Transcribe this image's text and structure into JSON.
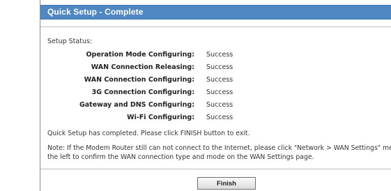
{
  "header": {
    "title": "Quick Setup - Complete"
  },
  "status": {
    "title": "Setup Status:",
    "rows": [
      {
        "label": "Operation Mode Configuring:",
        "value": "Success"
      },
      {
        "label": "WAN Connection Releasing:",
        "value": "Success"
      },
      {
        "label": "WAN Connection Configuring:",
        "value": "Success"
      },
      {
        "label": "3G Connection Configuring:",
        "value": "Success"
      },
      {
        "label": "Gateway and DNS Configuring:",
        "value": "Success"
      },
      {
        "label": "Wi-Fi Configuring:",
        "value": "Success"
      }
    ]
  },
  "messages": {
    "complete": "Quick Setup has completed. Please click FINISH button to exit.",
    "note_line1": "Note: If the Modem Router still can not connect to the Internet, please click \"Network > WAN Settings\" menu",
    "note_line2": "the left to confirm the WAN connection type and mode on the WAN Settings page."
  },
  "actions": {
    "finish_label": "Finish"
  },
  "colors": {
    "header_bg": "#4f87c2",
    "header_text": "#ffffff",
    "page_bg": "#ffffff"
  }
}
